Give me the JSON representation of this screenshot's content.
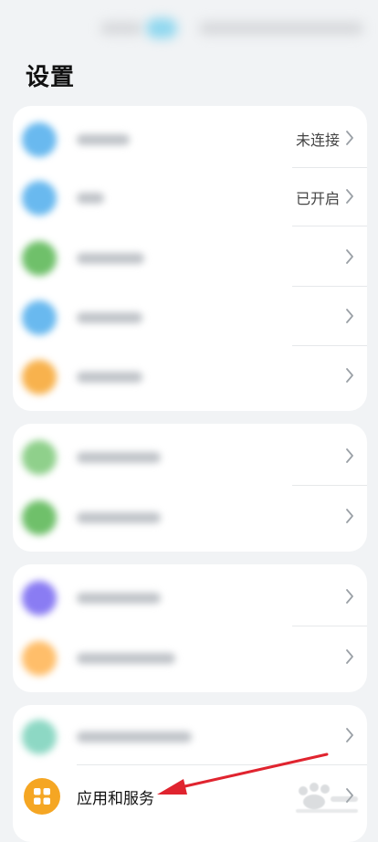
{
  "page": {
    "title": "设置"
  },
  "groups": [
    {
      "rows": [
        {
          "icon": "wifi-icon",
          "icon_color": "#69b9ef",
          "value": "未连接"
        },
        {
          "icon": "bluetooth-icon",
          "icon_color": "#69b9ef",
          "value": "已开启"
        },
        {
          "icon": "mobile-network-icon",
          "icon_color": "#6fc06a",
          "value": ""
        },
        {
          "icon": "more-connections-icon",
          "icon_color": "#69b9ef",
          "value": ""
        },
        {
          "icon": "desktop-wallpaper-icon",
          "icon_color": "#f8b24d",
          "value": ""
        }
      ]
    },
    {
      "rows": [
        {
          "icon": "display-icon",
          "icon_color": "#8fd08b",
          "value": ""
        },
        {
          "icon": "sound-icon",
          "icon_color": "#6fc06a",
          "value": ""
        }
      ]
    },
    {
      "rows": [
        {
          "icon": "notifications-icon",
          "icon_color": "#8a7cf3",
          "value": ""
        },
        {
          "icon": "biometrics-icon",
          "icon_color": "#ffbe6a",
          "value": ""
        }
      ]
    },
    {
      "rows": [
        {
          "icon": "apps-blurred-icon",
          "icon_color": "#8dd8c4",
          "value": ""
        },
        {
          "icon": "apps-services-icon",
          "icon_color": "#f5a623",
          "label": "应用和服务"
        }
      ]
    }
  ],
  "colors": {
    "background": "#f1f3f5",
    "card": "#ffffff",
    "annotation_arrow": "#e0242f",
    "app_icon": "#f5a623"
  }
}
